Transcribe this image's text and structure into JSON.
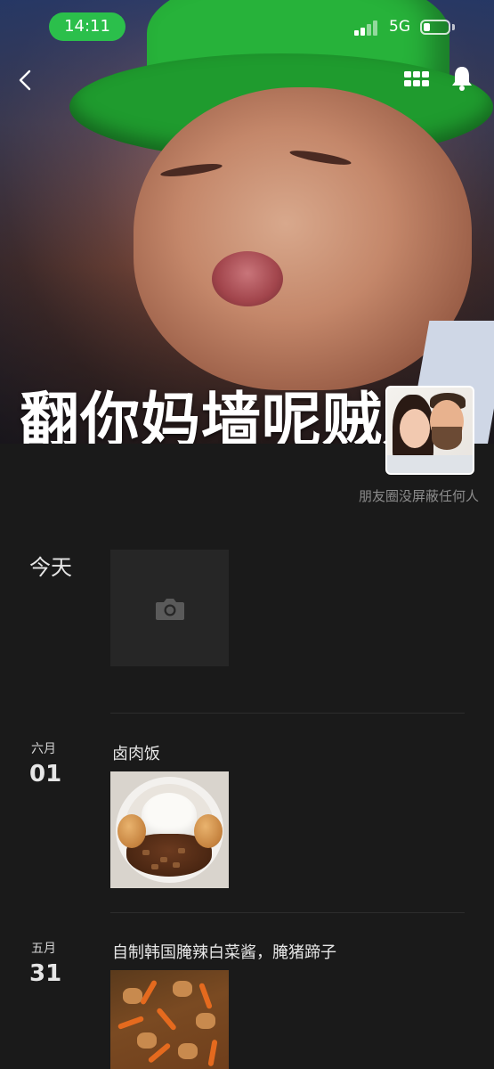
{
  "status_bar": {
    "time": "14:11",
    "network": "5G",
    "battery_icon": "battery-icon",
    "signal_icon": "signal-icon"
  },
  "nav": {
    "back_icon": "chevron-left-icon",
    "grid_icon": "grid-icon",
    "bell_icon": "bell-icon"
  },
  "cover": {
    "caption": "翻你妈墙呢贼贼"
  },
  "profile": {
    "privacy_note": "朋友圈没屏蔽任何人"
  },
  "timeline": {
    "today": {
      "label": "今天",
      "action_icon": "camera-icon"
    },
    "posts": [
      {
        "month": "六月",
        "day": "01",
        "text": "卤肉饭"
      },
      {
        "month": "五月",
        "day": "31",
        "text": "自制韩国腌辣白菜酱，腌猪蹄子"
      }
    ]
  },
  "colors": {
    "background": "#1a1a1a",
    "time_pill": "#2bbf4b",
    "hat_green": "#27b23a",
    "muted_text": "#8c8c8c"
  }
}
